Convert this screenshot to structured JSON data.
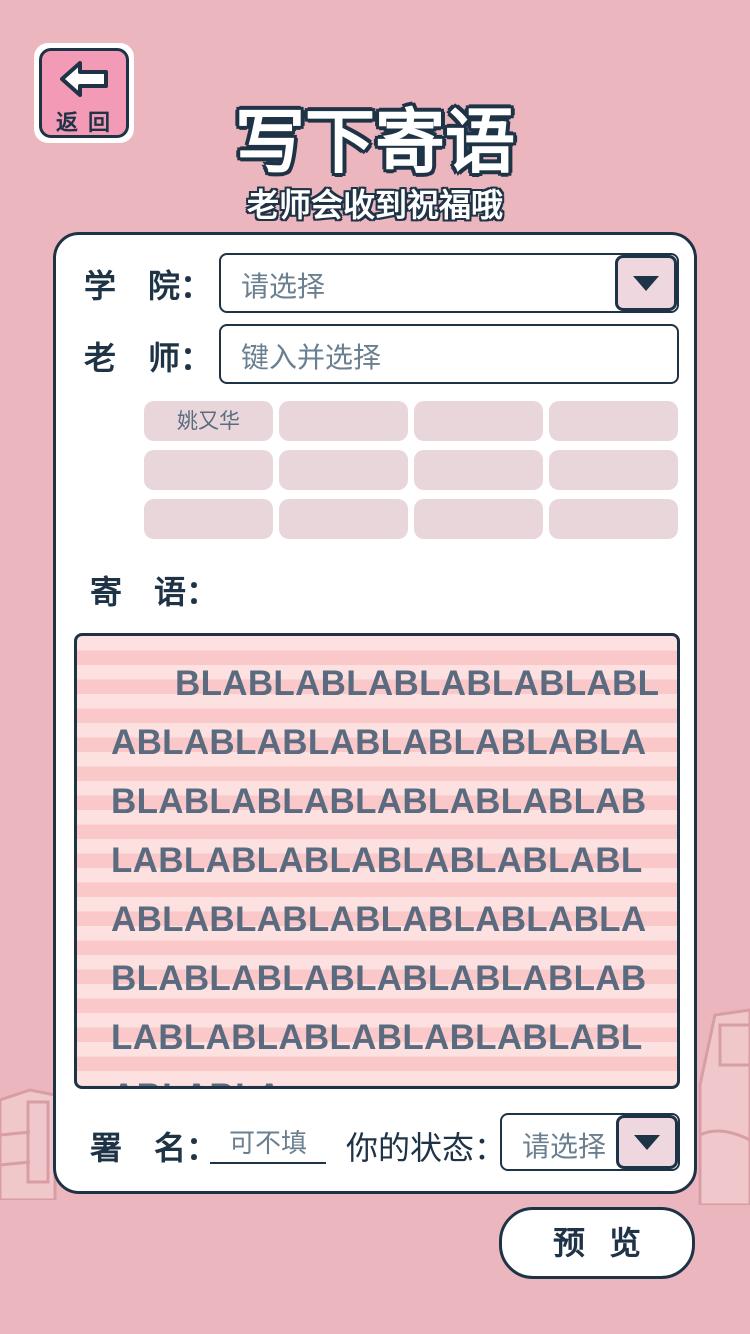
{
  "colors": {
    "background": "#ebb6bd",
    "accent": "#f29ab6",
    "ink": "#1f3346",
    "chip": "#e9d6db"
  },
  "header": {
    "back_label": "返回",
    "title": "写下寄语",
    "subtitle": "老师会收到祝福哦"
  },
  "form": {
    "college_label": "学　院：",
    "college_placeholder": "请选择",
    "teacher_label": "老　师：",
    "teacher_placeholder": "键入并选择",
    "teacher_suggestions": [
      "姚又华",
      "",
      "",
      "",
      "",
      "",
      "",
      "",
      "",
      "",
      "",
      ""
    ],
    "message_label": "寄　语：",
    "message_text": "BLABLABLABLABLABLABLABLABLABLABLABLABLABLABLABLABLABLABLABLABLABLABLABLABLABLABLABLABLABLABLABLABLABLABLABLABLABLABLABLABLABLABLABLABLABLABLABLABLABLABLABLABLA.....",
    "signature_label": "署　名：",
    "signature_placeholder": "可不填",
    "status_label": "你的状态：",
    "status_placeholder": "请选择"
  },
  "actions": {
    "preview_label": "预览"
  }
}
